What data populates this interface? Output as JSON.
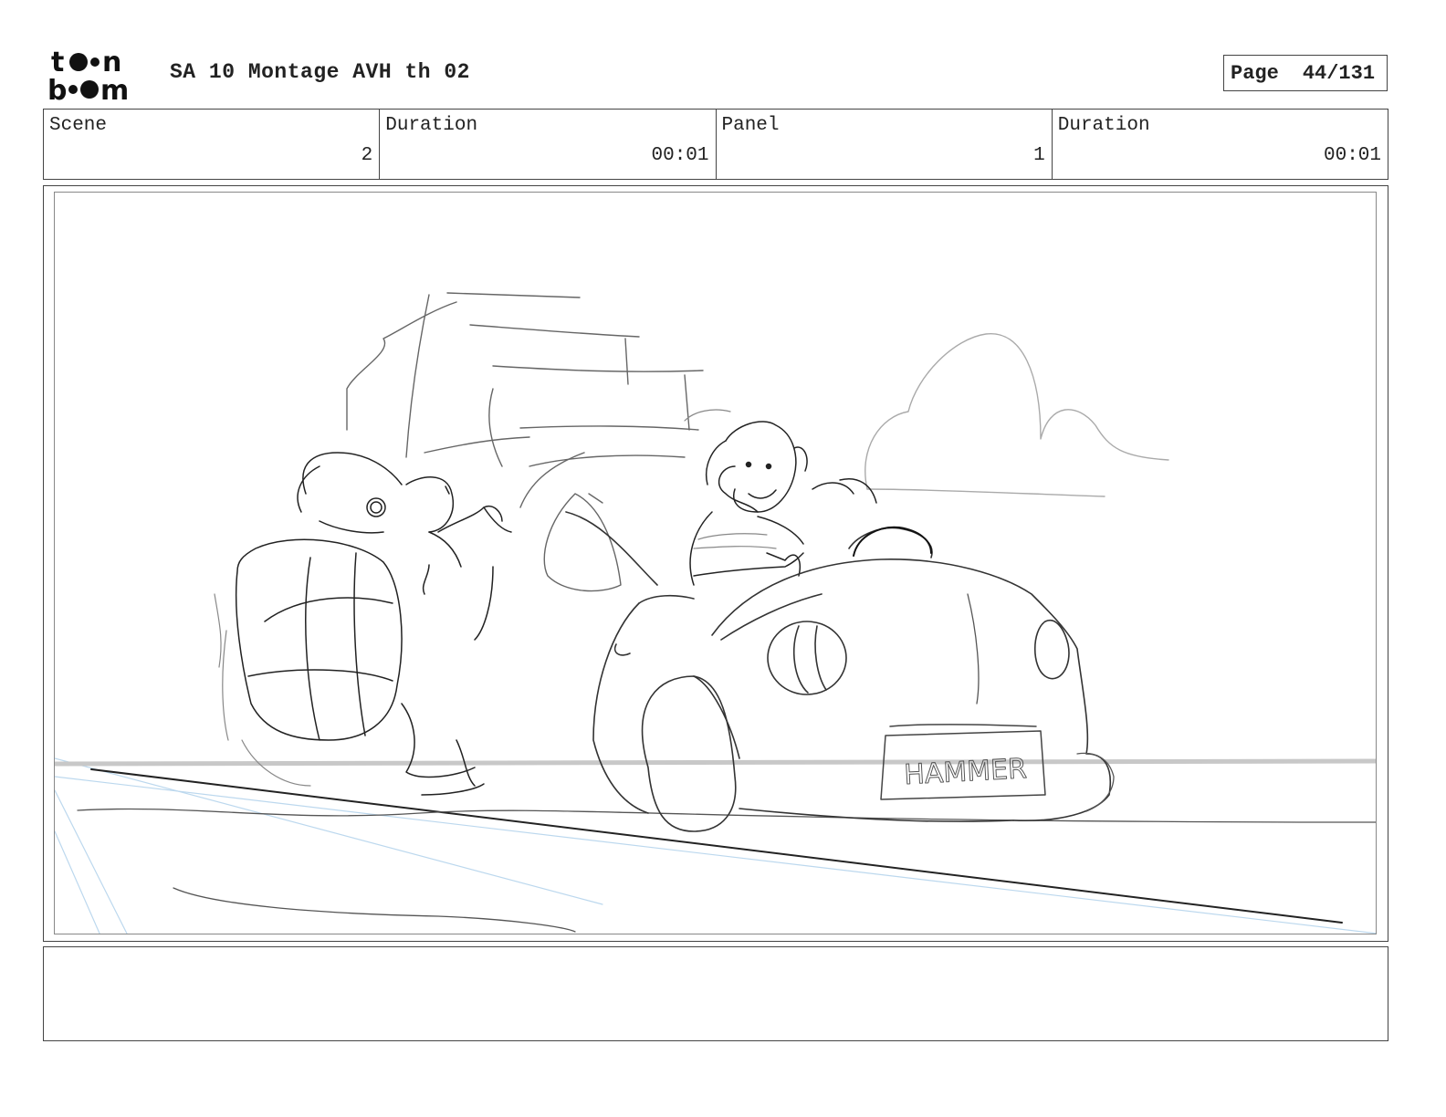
{
  "header": {
    "logo_text": "toon boom",
    "title": "SA 10 Montage AVH th 02",
    "page_label": "Page",
    "page_number": "44/131"
  },
  "info": [
    {
      "label": "Scene",
      "value": "2"
    },
    {
      "label": "Duration",
      "value": "00:01"
    },
    {
      "label": "Panel",
      "value": "1"
    },
    {
      "label": "Duration",
      "value": "00:01"
    }
  ],
  "panel": {
    "license_plate_text": "HAMMER"
  },
  "notes": {
    "text": ""
  }
}
